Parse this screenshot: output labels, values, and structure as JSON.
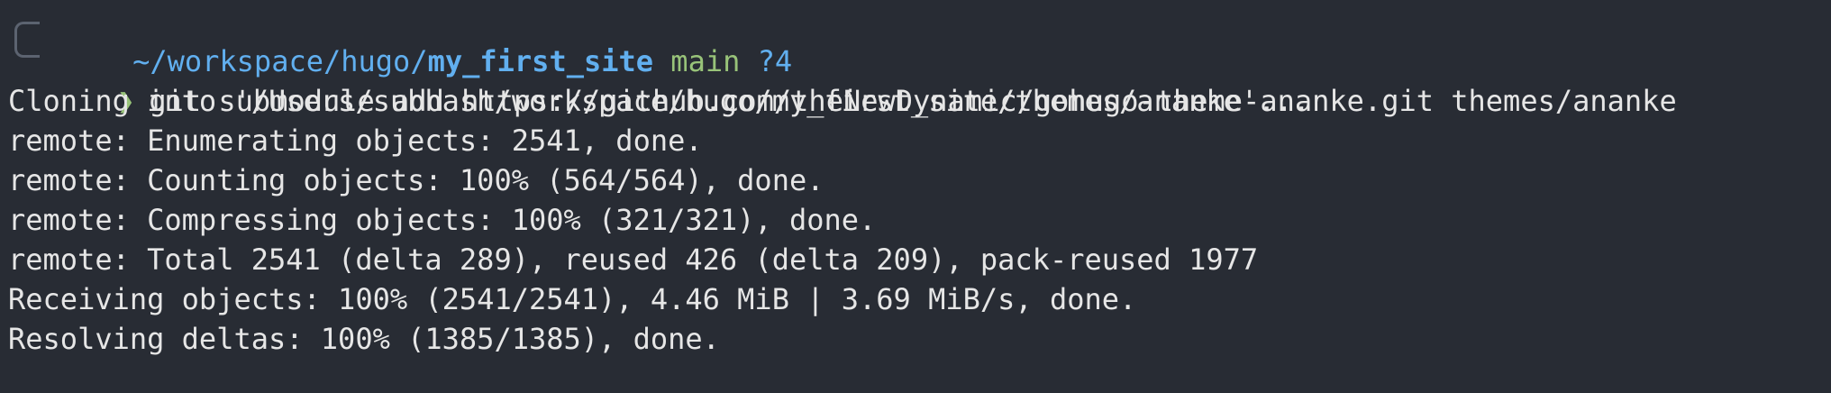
{
  "prompt": {
    "path_prefix": "~/workspace/hugo/",
    "repo": "my_first_site",
    "branch": "main",
    "status": "?4",
    "symbol": "❯"
  },
  "command": "git submodule add https://github.com/theNewDynamic/gohugo-theme-ananke.git themes/ananke",
  "output_lines": [
    "Cloning into '/Users/subhash/workspace/hugo/my_first_site/themes/ananke'...",
    "remote: Enumerating objects: 2541, done.",
    "remote: Counting objects: 100% (564/564), done.",
    "remote: Compressing objects: 100% (321/321), done.",
    "remote: Total 2541 (delta 289), reused 426 (delta 209), pack-reused 1977",
    "Receiving objects: 100% (2541/2541), 4.46 MiB | 3.69 MiB/s, done.",
    "Resolving deltas: 100% (1385/1385), done."
  ],
  "colors": {
    "background": "#282c34",
    "text": "#e6e6e6",
    "path": "#61afef",
    "branch": "#98c379",
    "prompt_symbol": "#98c379",
    "bracket": "#5c6370"
  }
}
